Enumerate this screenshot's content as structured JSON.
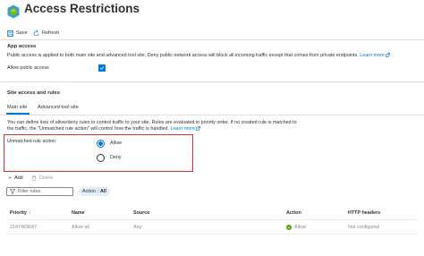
{
  "header": {
    "title": "Access Restrictions",
    "more_label": "···",
    "icon": "app-service-globe-icon"
  },
  "toolbar": {
    "save_label": "Save",
    "refresh_label": "Refresh"
  },
  "app_access": {
    "title": "App access",
    "description": "Public access is applied to both main site and advanced tool site. Deny public network access will block all incoming traffic except that comes from private endpoints.",
    "learn_more": "Learn more",
    "allow_public_label": "Allow public access",
    "allow_public_checked": true
  },
  "site_access": {
    "title": "Site access and rules",
    "tabs": [
      {
        "label": "Main site",
        "selected": true
      },
      {
        "label": "Advanced tool site",
        "selected": false
      }
    ],
    "description_line1": "You can define lists of allow/deny rules to control traffic to your site. Rules are evaluated in priority order. If no created rule is matched to",
    "description_line2": "the traffic, the \"Unmatched rule action\" will control how the traffic is handled.",
    "learn_more": "Learn more"
  },
  "unmatched_rule": {
    "label": "Unmatched rule action",
    "options": [
      {
        "label": "Allow",
        "selected": true
      },
      {
        "label": "Deny",
        "selected": false
      }
    ]
  },
  "rules_toolbar": {
    "add_label": "Add",
    "delete_label": "Delete"
  },
  "filter": {
    "placeholder": "Filter rules",
    "pill_key": "Action :",
    "pill_value": "All"
  },
  "table": {
    "columns": [
      "Priority",
      "Name",
      "Source",
      "Action",
      "HTTP headers"
    ],
    "priority_sort_glyph": "↕",
    "rows": [
      {
        "priority": "2147483647",
        "name": "Allow all",
        "source": "Any",
        "action": "Allow",
        "http_headers": "Not configured"
      }
    ]
  },
  "colors": {
    "accent": "#0078d4",
    "highlight": "#d13438",
    "success": "#57a300"
  }
}
